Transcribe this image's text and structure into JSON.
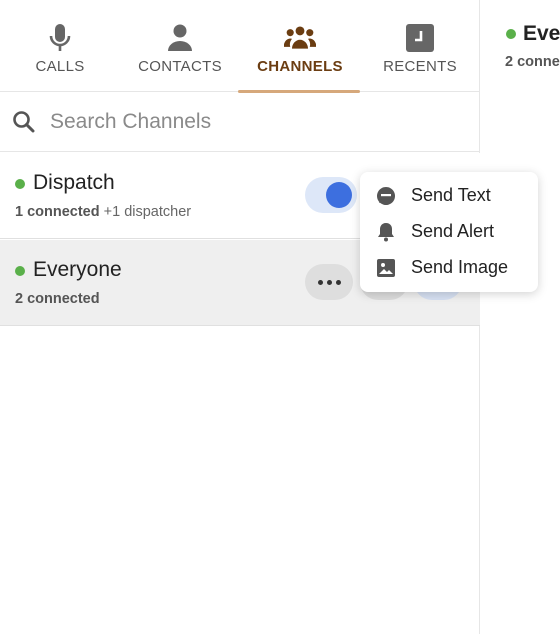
{
  "tabs": [
    {
      "label": "CALLS",
      "icon": "microphone-icon"
    },
    {
      "label": "CONTACTS",
      "icon": "person-icon"
    },
    {
      "label": "CHANNELS",
      "icon": "group-icon",
      "active": true
    },
    {
      "label": "RECENTS",
      "icon": "recents-icon"
    }
  ],
  "search": {
    "placeholder": "Search Channels"
  },
  "channels": [
    {
      "name": "Dispatch",
      "connected": "1 connected",
      "extra": "+1 dispatcher",
      "status_color": "#5ab04a"
    },
    {
      "name": "Everyone",
      "connected": "2 connected",
      "extra": "",
      "status_color": "#5ab04a"
    }
  ],
  "detail": {
    "title": "Eve",
    "subtitle": "2 conne"
  },
  "menu": {
    "items": [
      {
        "label": "Send Text",
        "icon": "message-icon"
      },
      {
        "label": "Send Alert",
        "icon": "bell-icon"
      },
      {
        "label": "Send Image",
        "icon": "image-icon"
      }
    ]
  },
  "colors": {
    "accent": "#6b3d12",
    "active_underline": "#d6a87b",
    "toggle_on": "#3d6fdf",
    "online": "#5ab04a"
  }
}
